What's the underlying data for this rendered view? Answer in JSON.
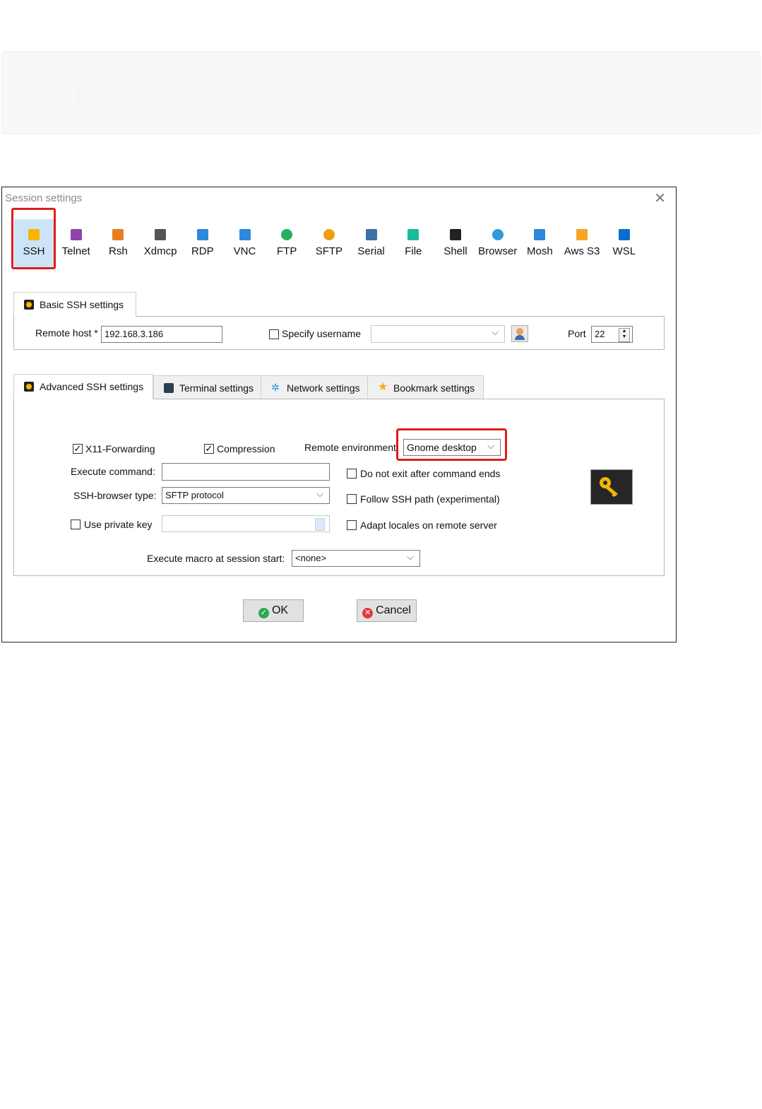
{
  "dialog": {
    "title": "Session settings",
    "close_icon": "close-icon"
  },
  "protocols": [
    {
      "label": "SSH",
      "icon": "ssh-key-icon",
      "color": "#f5b500"
    },
    {
      "label": "Telnet",
      "icon": "telnet-icon",
      "color": "#8e44ad"
    },
    {
      "label": "Rsh",
      "icon": "rsh-icon",
      "color": "#e67e22"
    },
    {
      "label": "Xdmcp",
      "icon": "xdmcp-icon",
      "color": "#555555"
    },
    {
      "label": "RDP",
      "icon": "rdp-icon",
      "color": "#2e86de"
    },
    {
      "label": "VNC",
      "icon": "vnc-icon",
      "color": "#2e86de"
    },
    {
      "label": "FTP",
      "icon": "ftp-icon",
      "color": "#27ae60"
    },
    {
      "label": "SFTP",
      "icon": "sftp-icon",
      "color": "#f39c12"
    },
    {
      "label": "Serial",
      "icon": "serial-icon",
      "color": "#3d6fa8"
    },
    {
      "label": "File",
      "icon": "file-icon",
      "color": "#1abc9c"
    },
    {
      "label": "Shell",
      "icon": "shell-icon",
      "color": "#222222"
    },
    {
      "label": "Browser",
      "icon": "browser-icon",
      "color": "#3498db"
    },
    {
      "label": "Mosh",
      "icon": "mosh-icon",
      "color": "#2e86de"
    },
    {
      "label": "Aws S3",
      "icon": "aws-s3-icon",
      "color": "#f5a623"
    },
    {
      "label": "WSL",
      "icon": "wsl-icon",
      "color": "#0a6ed1"
    }
  ],
  "basic": {
    "tab_label": "Basic SSH settings",
    "remote_host_label": "Remote host *",
    "remote_host_value": "192.168.3.186",
    "specify_username_label": "Specify username",
    "username_value": "",
    "port_label": "Port",
    "port_value": "22"
  },
  "advanced_tabs": [
    {
      "label": "Advanced SSH settings",
      "icon": "ssh-key-icon"
    },
    {
      "label": "Terminal settings",
      "icon": "terminal-icon"
    },
    {
      "label": "Network settings",
      "icon": "network-icon"
    },
    {
      "label": "Bookmark settings",
      "icon": "star-icon"
    }
  ],
  "advanced": {
    "x11_label": "X11-Forwarding",
    "x11_checked": true,
    "compression_label": "Compression",
    "compression_checked": true,
    "remote_env_label": "Remote environment",
    "remote_env_value": "Gnome desktop",
    "execute_command_label": "Execute command:",
    "execute_command_value": "",
    "do_not_exit_label": "Do not exit after command ends",
    "ssh_browser_label": "SSH-browser type:",
    "ssh_browser_value": "SFTP protocol",
    "follow_ssh_label": "Follow SSH path (experimental)",
    "use_private_key_label": "Use private key",
    "adapt_locales_label": "Adapt locales on remote server",
    "macro_label": "Execute macro at session start:",
    "macro_value": "<none>"
  },
  "buttons": {
    "ok": "OK",
    "cancel": "Cancel"
  },
  "colors": {
    "highlight_red": "#e01d1d",
    "selected_bg": "#cce4f7"
  }
}
